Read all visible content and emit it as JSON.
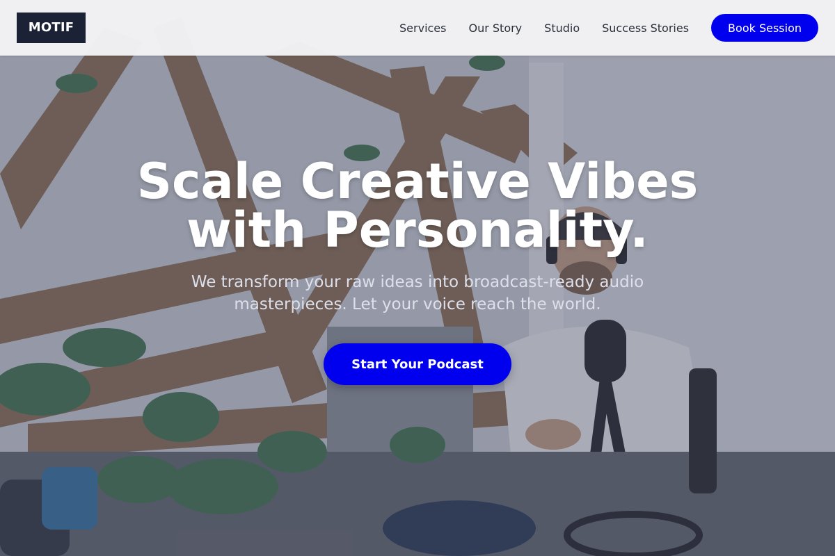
{
  "header": {
    "logo": "MOTIF",
    "nav": [
      {
        "label": "Services"
      },
      {
        "label": "Our Story"
      },
      {
        "label": "Studio"
      },
      {
        "label": "Success Stories"
      }
    ],
    "cta_label": "Book Session"
  },
  "hero": {
    "title_lines": [
      "Scale Creative Vibes",
      "with Personality."
    ],
    "subtitle_lines": [
      "We transform your raw ideas into broadcast-ready audio",
      "masterpieces. Let your voice reach the world."
    ],
    "cta_label": "Start Your Podcast",
    "image_subject": "podcast studio with host wearing headphones, microphone, laptop, potted plants and wooden beams"
  },
  "colors": {
    "accent": "#0000ee",
    "logo_bg": "#1b2236",
    "header_bg": "#f4f4f6",
    "overlay": "#464c64"
  }
}
